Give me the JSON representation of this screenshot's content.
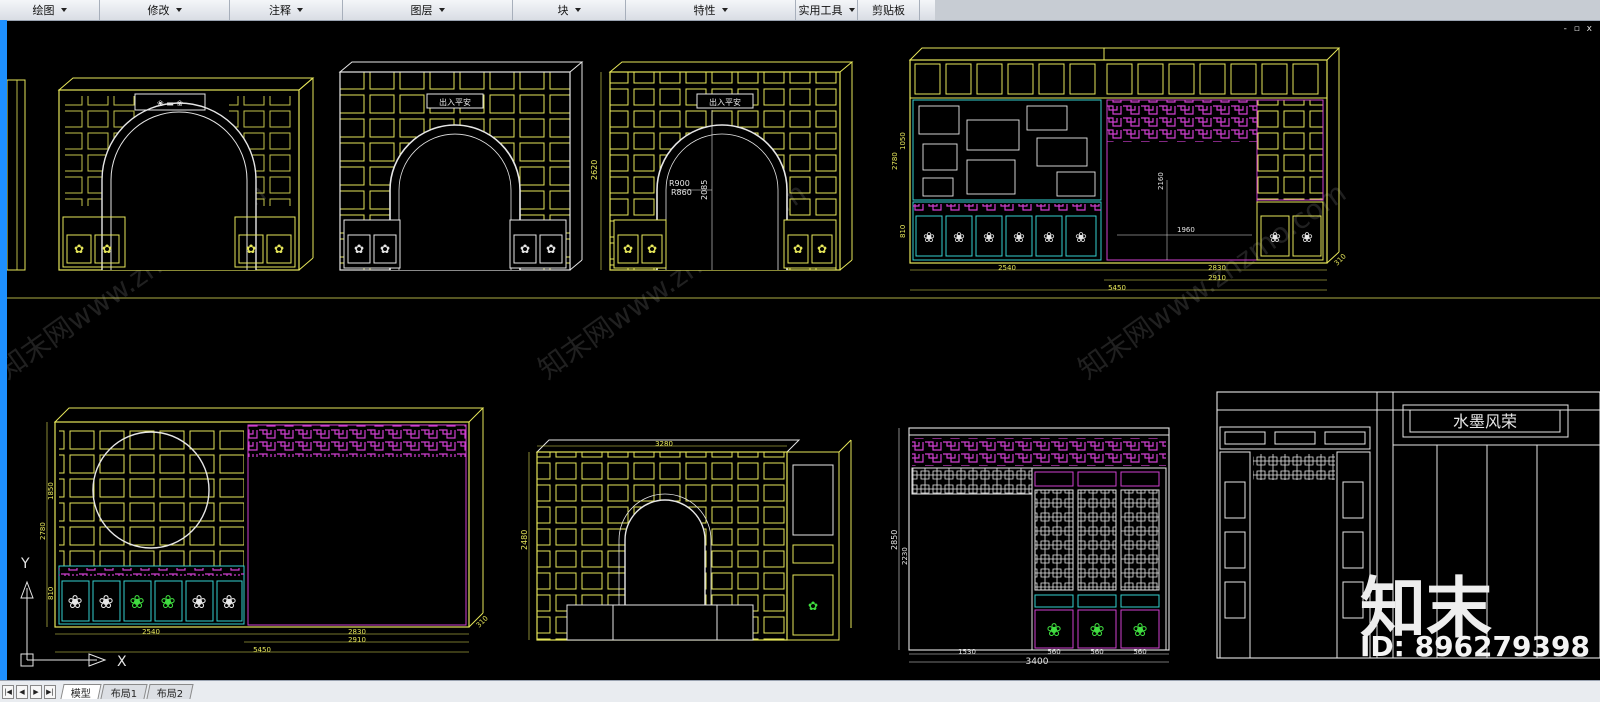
{
  "ribbon": {
    "tabs": [
      {
        "label": "绘图",
        "dropdown": true
      },
      {
        "label": "修改",
        "dropdown": true
      },
      {
        "label": "注释",
        "dropdown": true
      },
      {
        "label": "图层",
        "dropdown": true
      },
      {
        "label": "块",
        "dropdown": true
      },
      {
        "label": "特性",
        "dropdown": true
      },
      {
        "label": "实用工具",
        "dropdown": true
      },
      {
        "label": "剪贴板",
        "dropdown": false
      }
    ]
  },
  "drawings": {
    "plaques": [
      "出入平安",
      "出入平安",
      "水墨风荣"
    ],
    "dimensions": {
      "d2620": "2620",
      "r900": "R900",
      "r860": "R860",
      "d2085": "2085",
      "d2540a": "2540",
      "d2830a": "2830",
      "d2910a": "2910",
      "d5450a": "5450",
      "d1960": "1960",
      "d2160": "2160",
      "d2780a": "2780",
      "d1050": "1050",
      "d810a": "810",
      "d310a": "310",
      "d1850": "1850",
      "d2780b": "2780",
      "d810b": "810",
      "d2540b": "2540",
      "d2830b": "2830",
      "d2910b": "2910",
      "d5450b": "5450",
      "d310b": "310",
      "d3280": "3280",
      "d2480": "2480",
      "d2850": "2850",
      "d2230": "2230",
      "d1530": "1530",
      "d560a": "560",
      "d560b": "560",
      "d560c": "560",
      "d3400": "3400"
    }
  },
  "ucs": {
    "x_label": "X",
    "y_label": "Y"
  },
  "watermark": {
    "text": "知末网www.znzmo.com",
    "logo": "知末",
    "id": "ID: 896279398"
  },
  "window_controls": "- ▫ x",
  "statusbar": {
    "nav": [
      "|◀",
      "◀",
      "▶",
      "▶|"
    ],
    "layout_tabs": [
      {
        "label": "模型",
        "active": true
      },
      {
        "label": "布局1",
        "active": false
      },
      {
        "label": "布局2",
        "active": false
      }
    ]
  },
  "colors": {
    "yellow": "#e6e65a",
    "white": "#e6e6e6",
    "cyan": "#35d0d0",
    "magenta": "#d040d0",
    "green": "#3fdc3f",
    "ribbon_bg": "#dfe3e8",
    "accent_blue": "#1e90ff"
  }
}
